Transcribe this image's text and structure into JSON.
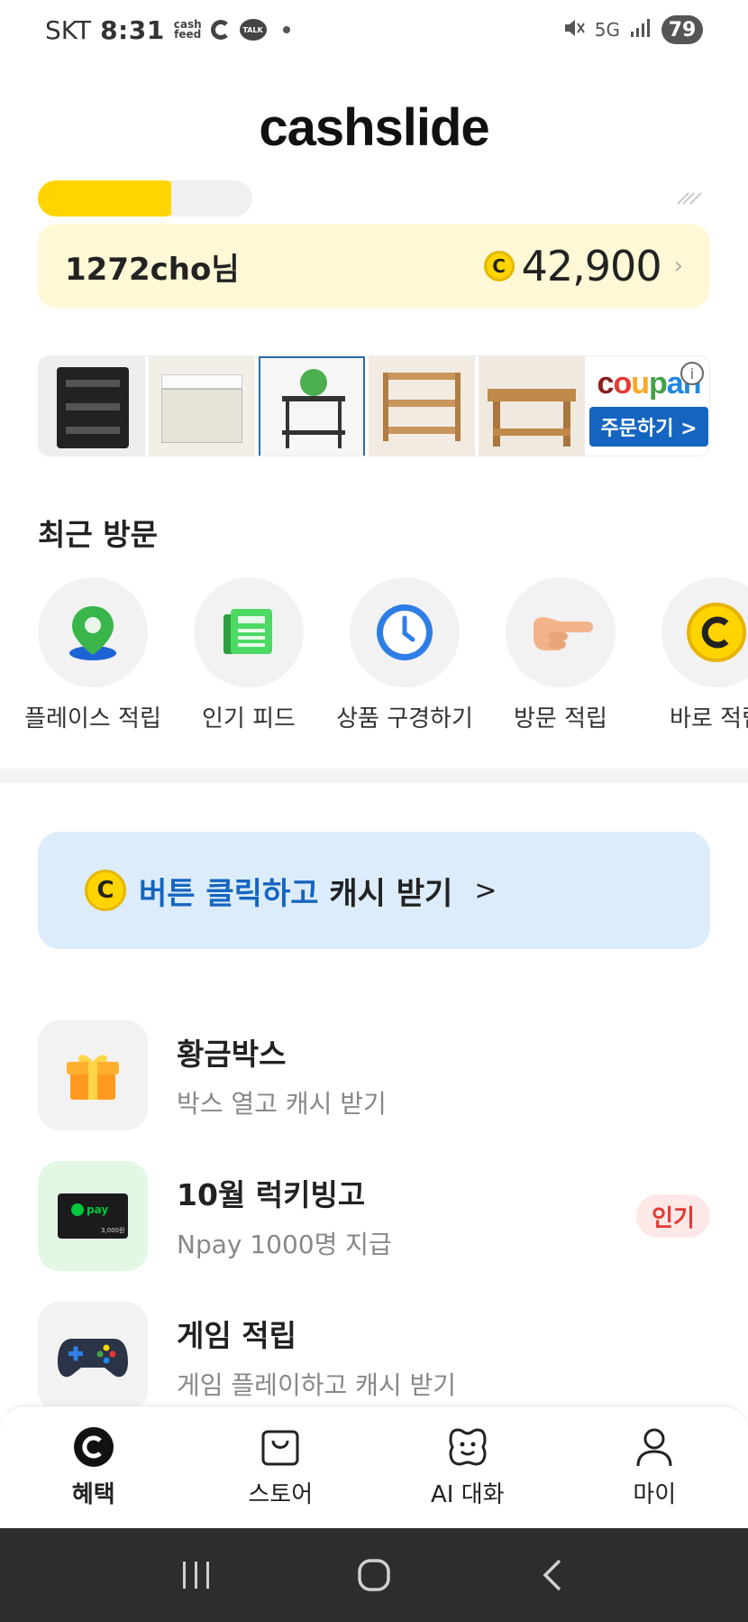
{
  "status_bar": {
    "carrier": "SKT",
    "time": "8:31",
    "battery": "79",
    "network": "5G"
  },
  "brand": "cashslide",
  "user_card": {
    "username": "1272cho님",
    "coin_symbol": "C",
    "amount": "42,900"
  },
  "ad": {
    "brand": "coupang",
    "button": "주문하기 >",
    "info": "i"
  },
  "recent": {
    "title": "최근 방문",
    "items": [
      {
        "label": "플레이스 적립",
        "icon": "map-pin-icon"
      },
      {
        "label": "인기 피드",
        "icon": "newspaper-icon"
      },
      {
        "label": "상품 구경하기",
        "icon": "clock-icon"
      },
      {
        "label": "방문 적립",
        "icon": "pointing-hand-icon"
      },
      {
        "label": "바로 적립",
        "icon": "coin-icon"
      }
    ]
  },
  "click_banner": {
    "highlight": "버튼 클릭하고",
    "rest": "캐시 받기",
    "chevron": ">"
  },
  "menu": [
    {
      "title": "황금박스",
      "subtitle": "박스 열고 캐시 받기",
      "icon": "gift-icon",
      "badge": ""
    },
    {
      "title": "10월 럭키빙고",
      "subtitle": "Npay 1000명 지급",
      "icon": "npay-card-icon",
      "badge": "인기",
      "card_text": "pay",
      "card_amount": "3,000원"
    },
    {
      "title": "게임 적립",
      "subtitle": "게임 플레이하고 캐시 받기",
      "icon": "gamepad-icon",
      "badge": ""
    }
  ],
  "bottom_nav": [
    {
      "label": "혜택",
      "icon": "benefit-c-icon"
    },
    {
      "label": "스토어",
      "icon": "shopping-bag-icon"
    },
    {
      "label": "AI 대화",
      "icon": "smile-bubble-icon"
    },
    {
      "label": "마이",
      "icon": "person-icon"
    }
  ],
  "system_nav": {
    "recent": "|||",
    "home": "○",
    "back": "‹"
  },
  "colors": {
    "accent_yellow": "#ffd400",
    "card_bg": "#fff8d6",
    "banner_bg": "#dcecfb",
    "brand_blue": "#1565c0",
    "hot_red": "#e53935"
  }
}
